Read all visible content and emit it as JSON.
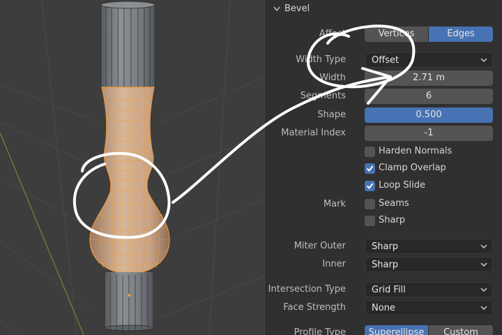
{
  "panel": {
    "header": {
      "title": "Bevel"
    },
    "affect": {
      "label": "Affect",
      "options": [
        "Vertices",
        "Edges"
      ],
      "selected": "Edges"
    },
    "width_type": {
      "label": "Width Type",
      "value": "Offset"
    },
    "width": {
      "label": "Width",
      "value": "2.71 m"
    },
    "segments": {
      "label": "Segments",
      "value": "6"
    },
    "shape": {
      "label": "Shape",
      "value": "0.500"
    },
    "material_index": {
      "label": "Material Index",
      "value": "-1"
    },
    "harden_normals": {
      "label": "Harden Normals",
      "checked": false
    },
    "clamp_overlap": {
      "label": "Clamp Overlap",
      "checked": true
    },
    "loop_slide": {
      "label": "Loop Slide",
      "checked": true
    },
    "mark": {
      "label": "Mark",
      "seams": "Seams",
      "sharp": "Sharp"
    },
    "miter_outer": {
      "label": "Miter Outer",
      "value": "Sharp"
    },
    "miter_inner": {
      "label": "Inner",
      "value": "Sharp"
    },
    "intersection_type": {
      "label": "Intersection Type",
      "value": "Grid Fill"
    },
    "face_strength": {
      "label": "Face Strength",
      "value": "None"
    },
    "profile_type": {
      "label": "Profile Type",
      "options": [
        "Superellipse",
        "Custom"
      ],
      "selected": "Superellipse"
    }
  },
  "colors": {
    "accent": "#4772b3",
    "selection": "#f0993a",
    "viewport_bg": "#3d3d3d",
    "panel_bg": "#303030"
  }
}
